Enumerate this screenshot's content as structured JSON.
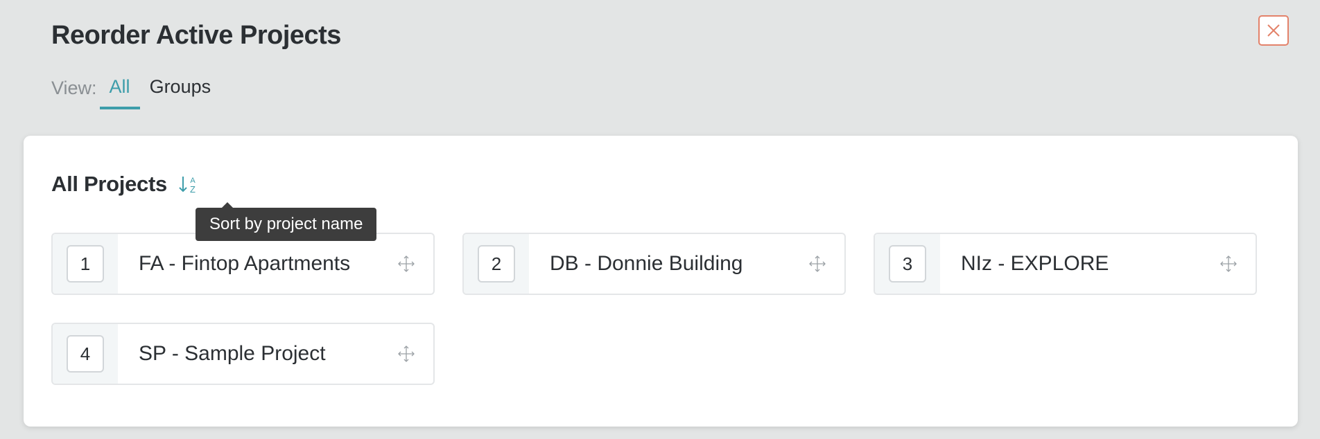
{
  "modal": {
    "title": "Reorder Active Projects",
    "close_icon": "close-icon",
    "accent_color": "#3d9daa",
    "close_color": "#e3826a"
  },
  "view": {
    "label": "View:",
    "tabs": [
      {
        "label": "All",
        "active": true
      },
      {
        "label": "Groups",
        "active": false
      }
    ]
  },
  "section": {
    "title": "All Projects",
    "sort_icon": "sort-alpha-down-icon",
    "tooltip": "Sort by project name"
  },
  "projects": [
    {
      "number": "1",
      "name": "FA - Fintop Apartments",
      "icon": "move-icon"
    },
    {
      "number": "2",
      "name": "DB - Donnie Building",
      "icon": "move-icon"
    },
    {
      "number": "3",
      "name": "NIz - EXPLORE",
      "icon": "move-icon"
    },
    {
      "number": "4",
      "name": "SP - Sample Project",
      "icon": "move-icon"
    }
  ]
}
